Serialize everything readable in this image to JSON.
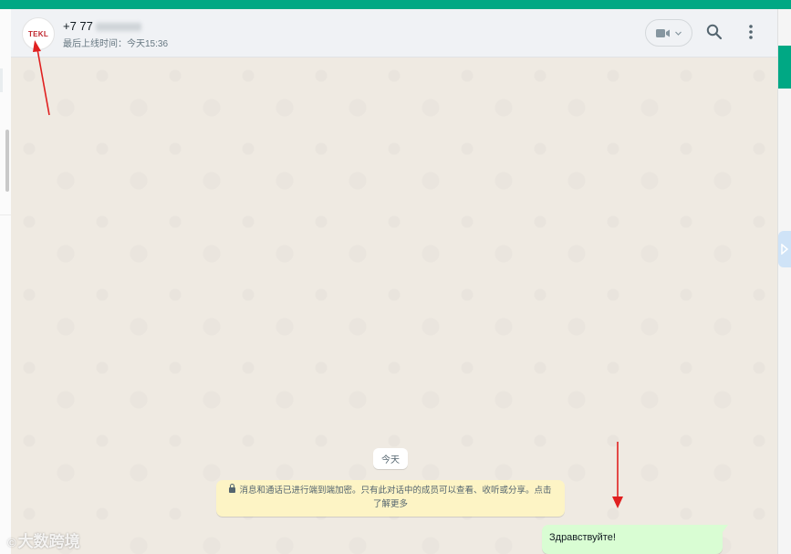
{
  "header": {
    "avatar_text": "TEKL",
    "contact_name": "+7 77",
    "last_seen": "最后上线时间：今天15:36"
  },
  "chat": {
    "date_label": "今天",
    "encryption_notice": "消息和通话已进行端到端加密。只有此对话中的成员可以查看、收听或分享。点击了解更多",
    "messages": [
      {
        "direction": "outgoing",
        "text": "Здравствуйте!"
      }
    ]
  },
  "watermark": {
    "text": "大数跨境"
  },
  "colors": {
    "accent": "#00a884",
    "chat_bg": "#efeae2",
    "outgoing_bubble": "#d9fdd3",
    "notice_bg": "#fdf4c5",
    "annotation_arrow": "#e02020"
  },
  "icons": [
    "avatar-logo",
    "video-call-icon",
    "search-icon",
    "menu-icon",
    "lock-icon"
  ]
}
